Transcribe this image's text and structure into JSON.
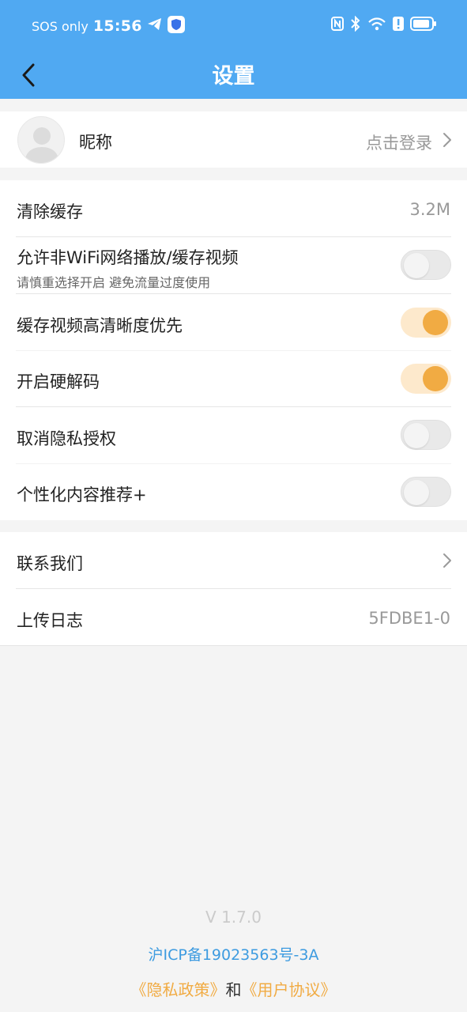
{
  "status_bar": {
    "sos": "SOS only",
    "time": "15:56",
    "icons": [
      "telegram-icon",
      "shield-icon",
      "nfc-icon",
      "bluetooth-icon",
      "wifi-icon",
      "alert-icon",
      "battery-icon"
    ]
  },
  "header": {
    "title": "设置",
    "back_icon": "chevron-left-icon"
  },
  "profile": {
    "nickname": "昵称",
    "login_label": "点击登录"
  },
  "settings": {
    "clear_cache": {
      "label": "清除缓存",
      "value": "3.2M"
    },
    "non_wifi": {
      "label": "允许非WiFi网络播放/缓存视频",
      "subtitle": "请慎重选择开启 避免流量过度使用",
      "enabled": false
    },
    "hd_first": {
      "label": "缓存视频高清晰度优先",
      "enabled": true
    },
    "hw_decode": {
      "label": "开启硬解码",
      "enabled": true
    },
    "revoke_privacy": {
      "label": "取消隐私授权",
      "enabled": false
    },
    "personalized": {
      "label": "个性化内容推荐+",
      "enabled": false
    }
  },
  "more": {
    "contact": {
      "label": "联系我们"
    },
    "upload_log": {
      "label": "上传日志",
      "value": "5FDBE1-0"
    }
  },
  "footer": {
    "version": "V 1.7.0",
    "icp": "沪ICP备19023563号-3A",
    "privacy_policy": "《隐私政策》",
    "and": "和",
    "user_agreement": "《用户协议》"
  },
  "colors": {
    "header_blue": "#50a9f2",
    "accent_orange": "#f1ab43",
    "toggle_on_track": "#fde9cc"
  }
}
